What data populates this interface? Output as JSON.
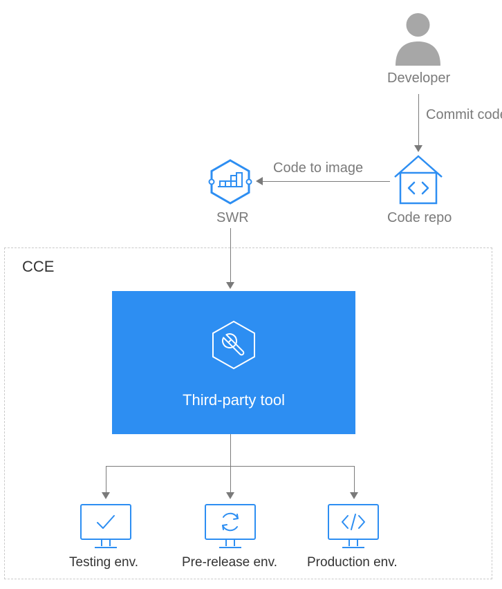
{
  "developer": {
    "label": "Developer"
  },
  "commitCode": {
    "label": "Commit code"
  },
  "codeRepo": {
    "label": "Code repo"
  },
  "codeToImage": {
    "label": "Code to image"
  },
  "swr": {
    "label": "SWR"
  },
  "cce": {
    "label": "CCE"
  },
  "thirdPartyTool": {
    "label": "Third-party tool"
  },
  "envs": {
    "testing": "Testing env.",
    "preRelease": "Pre-release env.",
    "production": "Production env."
  },
  "colors": {
    "blue": "#2d8ef2",
    "gray": "#a7a7a7"
  }
}
